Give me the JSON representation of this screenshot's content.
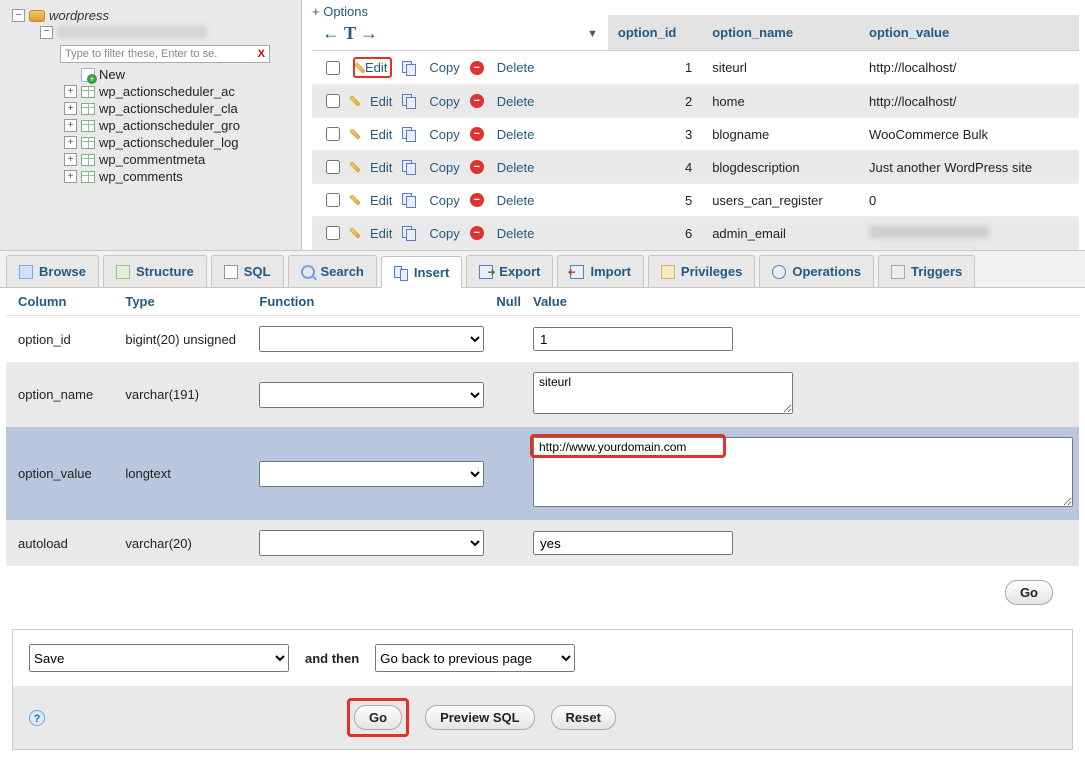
{
  "tree": {
    "database": "wordpress",
    "filter_placeholder": "Type to filter these, Enter to se.",
    "new_label": "New",
    "tables": [
      "wp_actionscheduler_ac",
      "wp_actionscheduler_cla",
      "wp_actionscheduler_gro",
      "wp_actionscheduler_log",
      "wp_commentmeta",
      "wp_comments"
    ]
  },
  "options_link": "+ Options",
  "table": {
    "headers": {
      "id": "option_id",
      "name": "option_name",
      "value": "option_value"
    },
    "action_labels": {
      "edit": "Edit",
      "copy": "Copy",
      "delete": "Delete"
    },
    "rows": [
      {
        "id": "1",
        "name": "siteurl",
        "value": "http://localhost/",
        "edit_hi": true
      },
      {
        "id": "2",
        "name": "home",
        "value": "http://localhost/",
        "alt": true
      },
      {
        "id": "3",
        "name": "blogname",
        "value": "WooCommerce Bulk"
      },
      {
        "id": "4",
        "name": "blogdescription",
        "value": "Just another WordPress site",
        "alt": true
      },
      {
        "id": "5",
        "name": "users_can_register",
        "value": "0"
      },
      {
        "id": "6",
        "name": "admin_email",
        "value": "",
        "alt": true,
        "blur": true
      }
    ]
  },
  "tabs": [
    {
      "key": "browse",
      "label": "Browse",
      "icon": "ti-browse"
    },
    {
      "key": "structure",
      "label": "Structure",
      "icon": "ti-struct"
    },
    {
      "key": "sql",
      "label": "SQL",
      "icon": "ti-sql"
    },
    {
      "key": "search",
      "label": "Search",
      "icon": "ti-search"
    },
    {
      "key": "insert",
      "label": "Insert",
      "icon": "ti-insert",
      "active": true
    },
    {
      "key": "export",
      "label": "Export",
      "icon": "ti-export"
    },
    {
      "key": "import",
      "label": "Import",
      "icon": "ti-import"
    },
    {
      "key": "privileges",
      "label": "Privileges",
      "icon": "ti-priv"
    },
    {
      "key": "operations",
      "label": "Operations",
      "icon": "ti-ops"
    },
    {
      "key": "triggers",
      "label": "Triggers",
      "icon": "ti-trig"
    }
  ],
  "form": {
    "headers": {
      "column": "Column",
      "type": "Type",
      "function": "Function",
      "null": "Null",
      "value": "Value"
    },
    "rows": [
      {
        "col": "option_id",
        "type": "bigint(20) unsigned",
        "value": "1",
        "kind": "s",
        "shade": false
      },
      {
        "col": "option_name",
        "type": "varchar(191)",
        "value": "siteurl",
        "kind": "m",
        "shade": true
      },
      {
        "col": "option_value",
        "type": "longtext",
        "value": "http://www.yourdomain.com",
        "kind": "l",
        "shade": false,
        "sel": true,
        "hi": true
      },
      {
        "col": "autoload",
        "type": "varchar(20)",
        "value": "yes",
        "kind": "s",
        "shade": true
      }
    ],
    "go": "Go"
  },
  "footer": {
    "save": "Save",
    "andthen": "and then",
    "goback": "Go back to previous page",
    "go": "Go",
    "preview": "Preview SQL",
    "reset": "Reset"
  }
}
